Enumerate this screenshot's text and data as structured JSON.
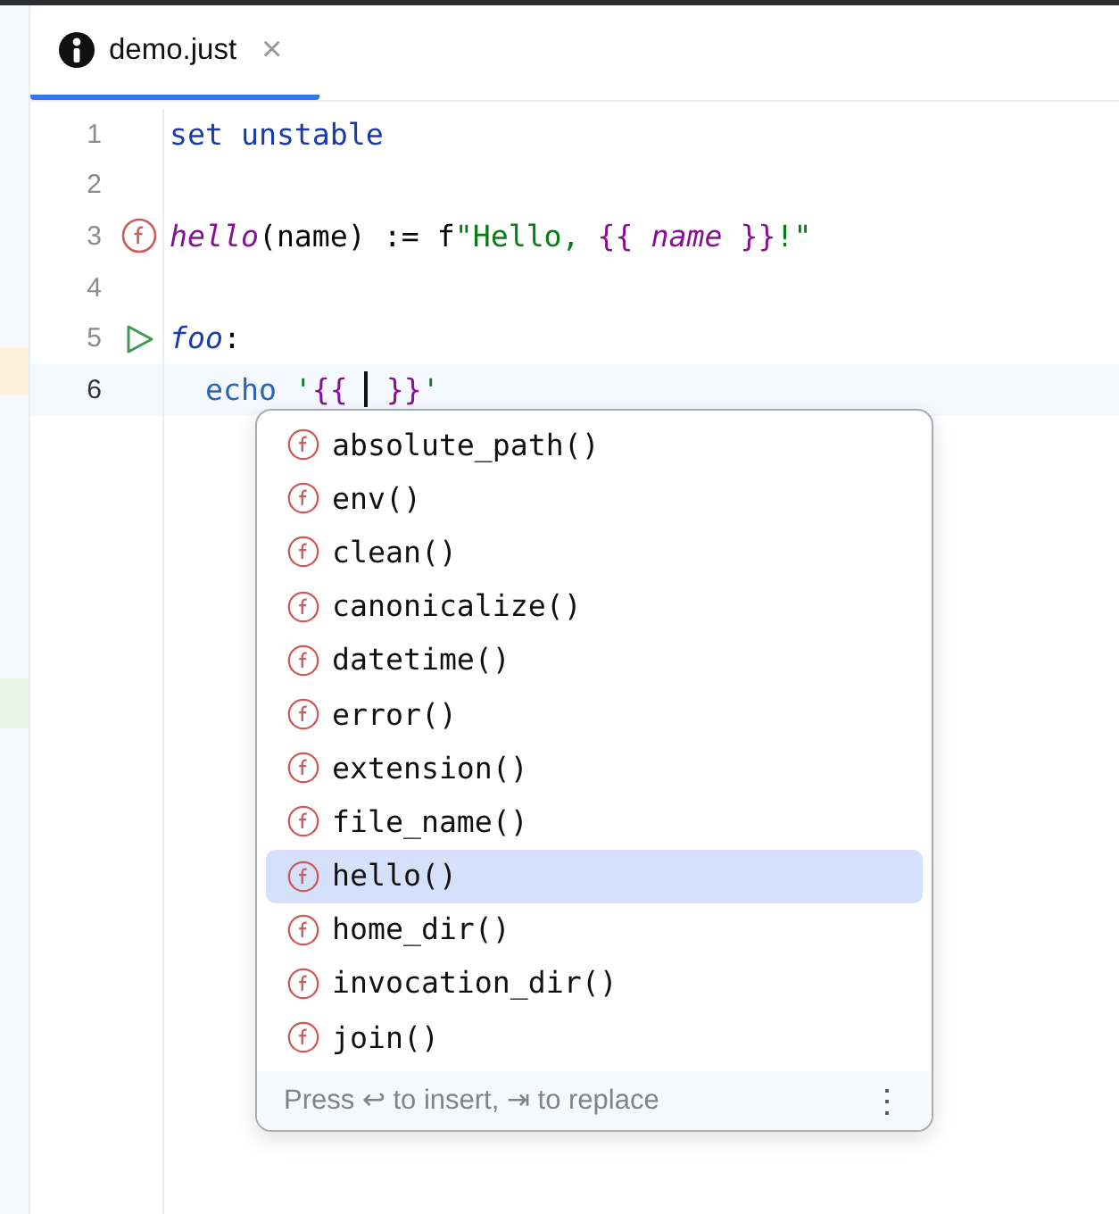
{
  "tab": {
    "title": "demo.just",
    "selected": true,
    "close": "×"
  },
  "lines": [
    {
      "number": "1",
      "kind": "setting",
      "current": false,
      "tokens": [
        {
          "text": "set unstable",
          "kind": "keyword"
        }
      ]
    },
    {
      "number": "2",
      "kind": "blank",
      "current": false
    },
    {
      "number": "3",
      "kind": "function",
      "current": false,
      "tokens": [
        {
          "text": "hello",
          "kind": "function"
        },
        {
          "text": "(name) := f",
          "kind": "plain"
        },
        {
          "text": "\"Hello, ",
          "kind": "string"
        },
        {
          "text": "{{ ",
          "kind": "interp"
        },
        {
          "text": "name",
          "kind": "interp-italic"
        },
        {
          "text": " }}",
          "kind": "interp"
        },
        {
          "text": "!\"",
          "kind": "string"
        }
      ]
    },
    {
      "number": "4",
      "kind": "blank",
      "current": false
    },
    {
      "number": "5",
      "kind": "recipe",
      "current": false,
      "tokens": [
        {
          "text": "foo",
          "kind": "recipe"
        },
        {
          "text": ":",
          "kind": "plain"
        }
      ]
    },
    {
      "number": "6",
      "kind": "body",
      "current": true,
      "tokens": [
        {
          "text": "echo",
          "kind": "command"
        },
        {
          "text": " '",
          "kind": "string"
        },
        {
          "text": "{{ ",
          "kind": "interp"
        },
        {
          "kind": "caret"
        },
        {
          "text": " }}",
          "kind": "interp"
        },
        {
          "text": "'",
          "kind": "string"
        }
      ]
    }
  ],
  "completion": {
    "items": [
      {
        "label": "absolute_path()",
        "selected": false
      },
      {
        "label": "env()",
        "selected": false
      },
      {
        "label": "clean()",
        "selected": false
      },
      {
        "label": "canonicalize()",
        "selected": false
      },
      {
        "label": "datetime()",
        "selected": false
      },
      {
        "label": "error()",
        "selected": false
      },
      {
        "label": "extension()",
        "selected": false
      },
      {
        "label": "file_name()",
        "selected": false
      },
      {
        "label": "hello()",
        "selected": true
      },
      {
        "label": "home_dir()",
        "selected": false
      },
      {
        "label": "invocation_dir()",
        "selected": false
      },
      {
        "label": "join()",
        "selected": false
      }
    ],
    "hint": "Press ↩ to insert, ⇥ to replace",
    "menu": "⋮"
  }
}
